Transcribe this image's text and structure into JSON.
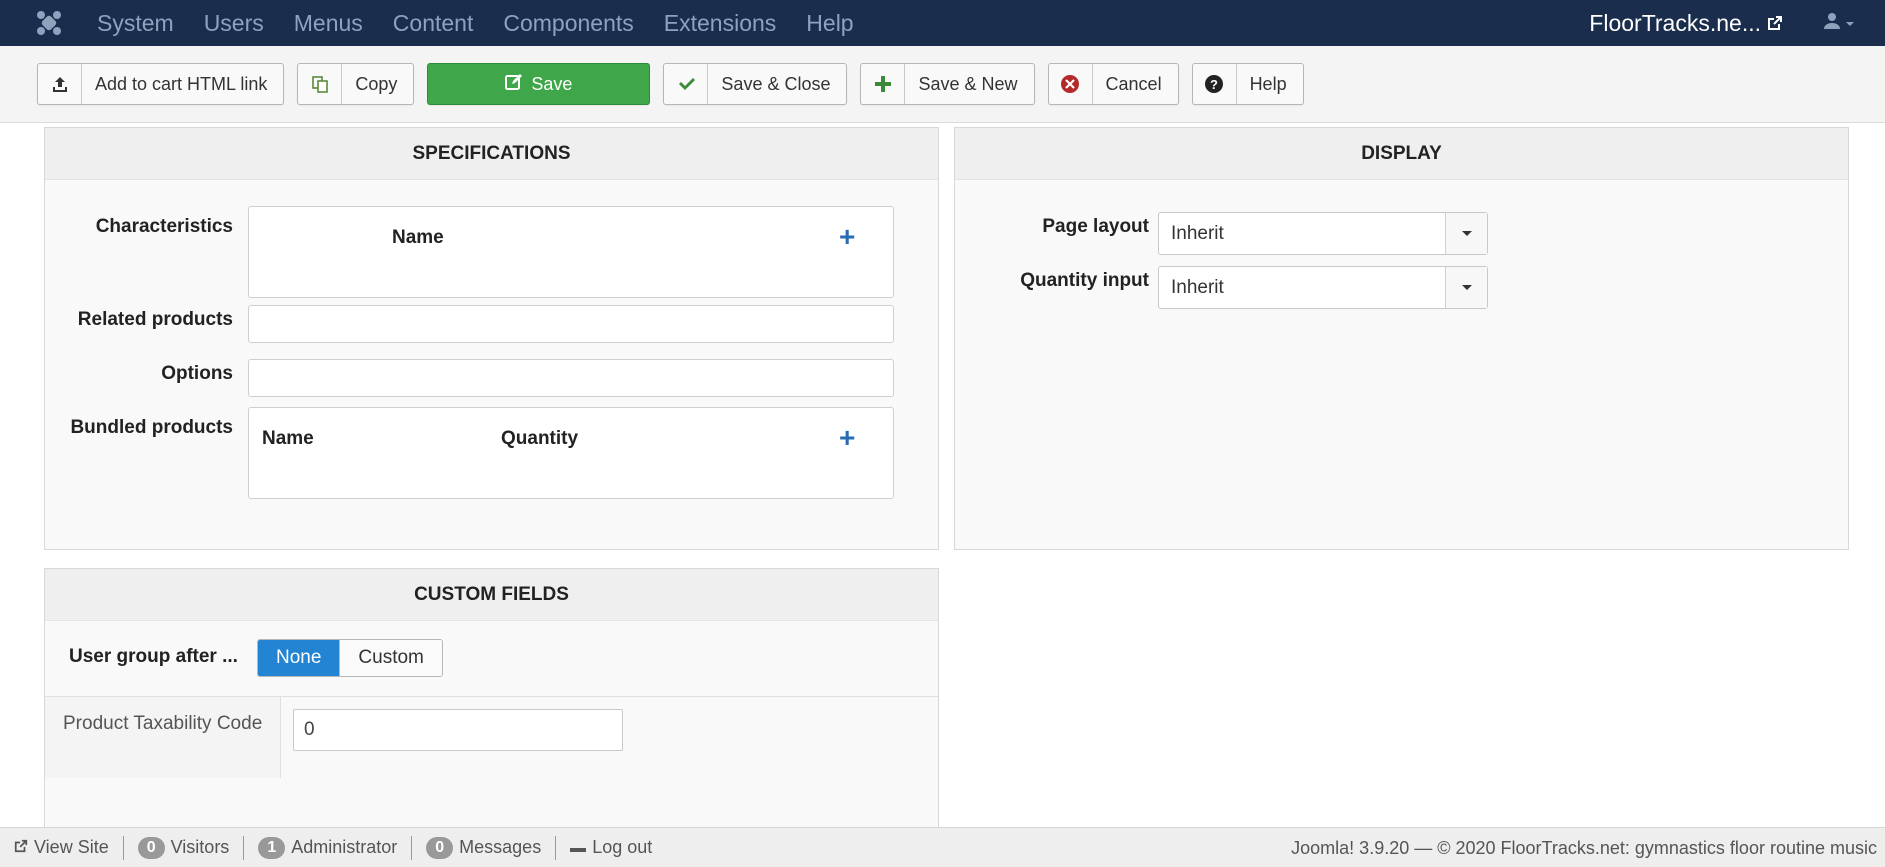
{
  "navbar": {
    "menu": [
      "System",
      "Users",
      "Menus",
      "Content",
      "Components",
      "Extensions",
      "Help"
    ],
    "site_name": "FloorTracks.ne..."
  },
  "toolbar": {
    "add_to_cart": "Add to cart HTML link",
    "copy": "Copy",
    "save": "Save",
    "save_close": "Save & Close",
    "save_new": "Save & New",
    "cancel": "Cancel",
    "help": "Help"
  },
  "specifications": {
    "title": "SPECIFICATIONS",
    "characteristics_label": "Characteristics",
    "characteristics_col_name": "Name",
    "related_label": "Related products",
    "options_label": "Options",
    "bundled_label": "Bundled products",
    "bundled_col_name": "Name",
    "bundled_col_quantity": "Quantity"
  },
  "display": {
    "title": "DISPLAY",
    "page_layout_label": "Page layout",
    "page_layout_value": "Inherit",
    "quantity_input_label": "Quantity input",
    "quantity_input_value": "Inherit"
  },
  "custom_fields": {
    "title": "CUSTOM FIELDS",
    "user_group_label": "User group after ...",
    "option_none": "None",
    "option_custom": "Custom",
    "taxability_label": "Product Taxability Code",
    "taxability_value": "0"
  },
  "statusbar": {
    "view_site": "View Site",
    "visitors_count": "0",
    "visitors_label": "Visitors",
    "admin_count": "1",
    "admin_label": "Administrator",
    "messages_count": "0",
    "messages_label": "Messages",
    "logout": "Log out",
    "footer": "Joomla! 3.9.20  —  © 2020 FloorTracks.net: gymnastics floor routine music"
  }
}
